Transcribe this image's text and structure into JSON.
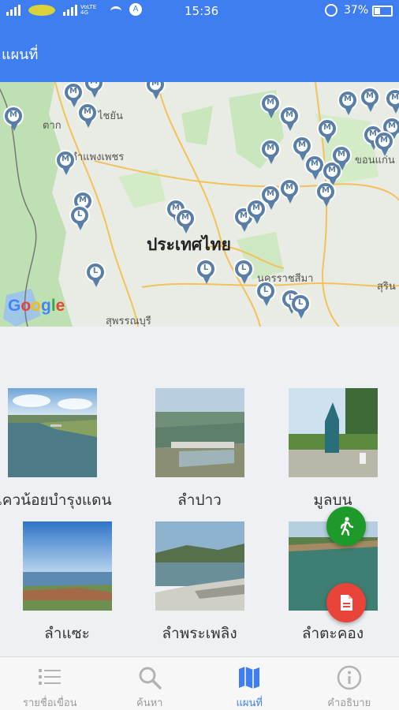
{
  "status_bar": {
    "time": "15:36",
    "battery": "37%",
    "carrier_badge": "VoLTE 4G"
  },
  "app_bar": {
    "title": "แผนที่"
  },
  "map": {
    "country_label": "ประเทศไทย",
    "place_labels": [
      "ตาก",
      "ไชยัน",
      "กำแพงเพชร",
      "นครราชสีมา",
      "สุพรรณบุรี",
      "สุริน",
      "ขอนแก่น"
    ],
    "google_logo": "Google",
    "marker_types": [
      "M",
      "L"
    ]
  },
  "dams": [
    {
      "name": "แควน้อยบำรุงแดน"
    },
    {
      "name": "ลำปาว"
    },
    {
      "name": "มูลบน"
    },
    {
      "name": "ลำแซะ"
    },
    {
      "name": "ลำพระเพลิง"
    },
    {
      "name": "ลำตะคอง"
    }
  ],
  "fabs": {
    "walk": {
      "icon": "walk-icon",
      "color": "#1e9a2a"
    },
    "document": {
      "icon": "document-icon",
      "color": "#e8443a"
    }
  },
  "bottom_nav": [
    {
      "label": "รายชื่อเขื่อน",
      "icon": "list-icon",
      "active": false
    },
    {
      "label": "ค้นหา",
      "icon": "search-icon",
      "active": false
    },
    {
      "label": "แผนที่",
      "icon": "map-icon",
      "active": true
    },
    {
      "label": "คำอธิบาย",
      "icon": "info-icon",
      "active": false
    }
  ],
  "colors": {
    "accent": "#3f7ef0",
    "pin": "#5a7fa6",
    "walk_fab": "#1e9a2a",
    "doc_fab": "#e8443a"
  }
}
